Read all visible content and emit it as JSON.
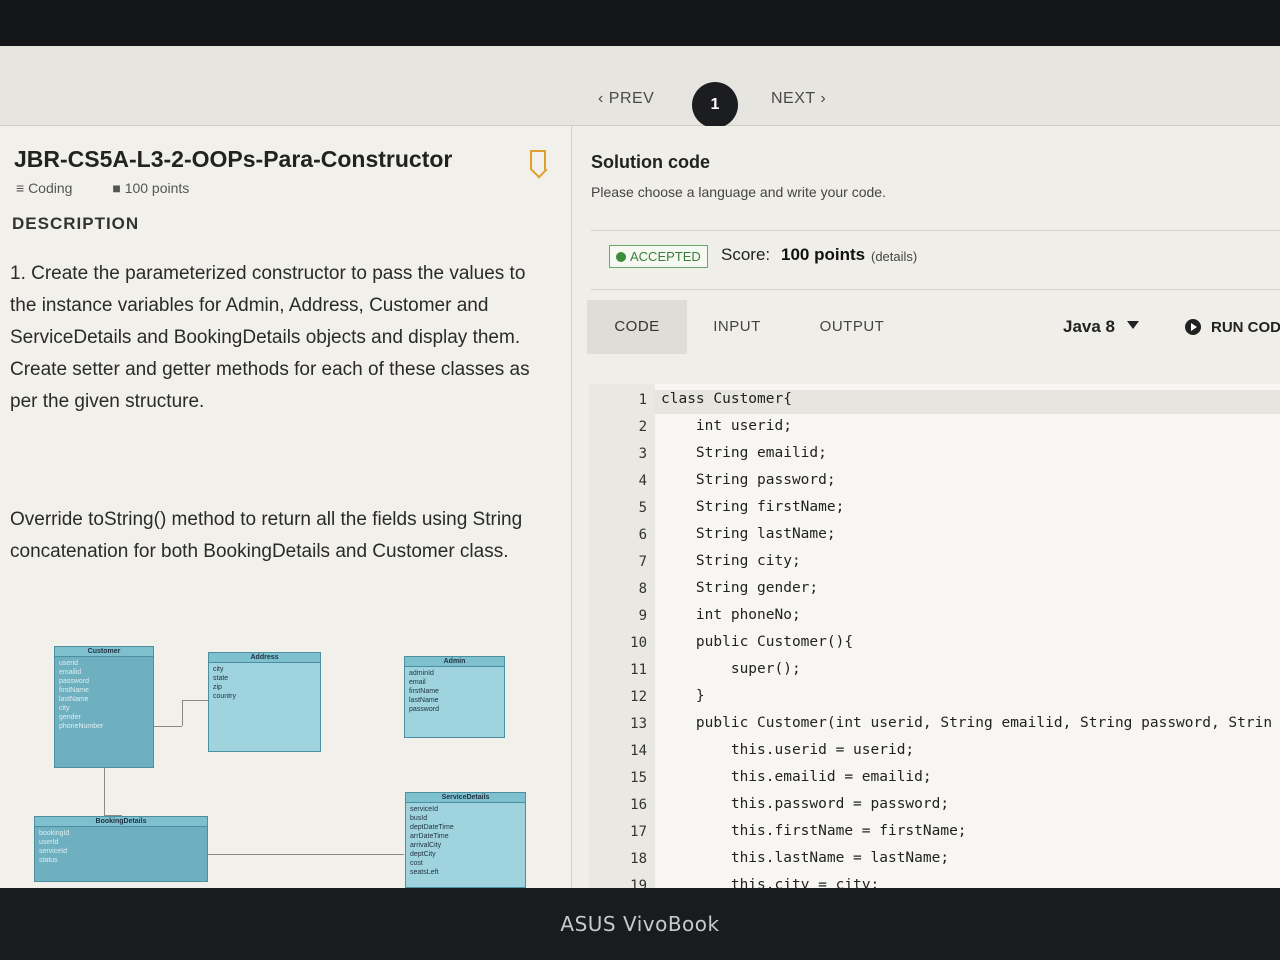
{
  "nav": {
    "prev": "PREV",
    "next": "NEXT",
    "page": "1"
  },
  "problem": {
    "title": "JBR-CS5A-L3-2-OOPs-Para-Constructor",
    "type": "Coding",
    "points": "100 points",
    "description_heading": "DESCRIPTION",
    "para1": "1. Create the parameterized constructor to pass the values to the instance variables for Admin, Address, Customer and ServiceDetails and BookingDetails objects and display them. Create setter and getter methods for each of these classes as per the given structure.",
    "para2": "Override toString() method to return all the fields using String concatenation for both BookingDetails and Customer class."
  },
  "uml": {
    "customer": {
      "name": "Customer",
      "fields": [
        "userid",
        "emailid",
        "password",
        "firstName",
        "lastName",
        "city",
        "gender",
        "phoneNumber"
      ]
    },
    "address": {
      "name": "Address",
      "fields": [
        "city",
        "state",
        "zip",
        "country"
      ]
    },
    "admin": {
      "name": "Admin",
      "fields": [
        "adminId",
        "email",
        "firstName",
        "lastName",
        "password"
      ]
    },
    "booking": {
      "name": "BookingDetails",
      "fields": [
        "bookingId",
        "userId",
        "serviceId",
        "status"
      ]
    },
    "service": {
      "name": "ServiceDetails",
      "fields": [
        "serviceId",
        "busId",
        "deptDateTime",
        "arrDateTime",
        "arrivalCity",
        "deptCity",
        "cost",
        "seatsLeft"
      ]
    }
  },
  "solution": {
    "title": "Solution code",
    "subtitle": "Please choose a language and write your code.",
    "status": "ACCEPTED",
    "score_label": "Score:",
    "score_value": "100 points",
    "score_details": "(details)",
    "tabs": [
      "CODE",
      "INPUT",
      "OUTPUT"
    ],
    "language": "Java 8",
    "run_label": "RUN CODE"
  },
  "code_lines": [
    {
      "n": "1",
      "text": "class Customer{"
    },
    {
      "n": "2",
      "text": "    int userid;"
    },
    {
      "n": "3",
      "text": "    String emailid;"
    },
    {
      "n": "4",
      "text": "    String password;"
    },
    {
      "n": "5",
      "text": "    String firstName;"
    },
    {
      "n": "6",
      "text": "    String lastName;"
    },
    {
      "n": "7",
      "text": "    String city;"
    },
    {
      "n": "8",
      "text": "    String gender;"
    },
    {
      "n": "9",
      "text": "    int phoneNo;"
    },
    {
      "n": "10",
      "text": "    public Customer(){"
    },
    {
      "n": "11",
      "text": "        super();"
    },
    {
      "n": "12",
      "text": "    }"
    },
    {
      "n": "13",
      "text": "    public Customer(int userid, String emailid, String password, Strin"
    },
    {
      "n": "14",
      "text": "        this.userid = userid;"
    },
    {
      "n": "15",
      "text": "        this.emailid = emailid;"
    },
    {
      "n": "16",
      "text": "        this.password = password;"
    },
    {
      "n": "17",
      "text": "        this.firstName = firstName;"
    },
    {
      "n": "18",
      "text": "        this.lastName = lastName;"
    },
    {
      "n": "19",
      "text": "        this.city = city;"
    }
  ],
  "brand": "ASUS VivoBook"
}
